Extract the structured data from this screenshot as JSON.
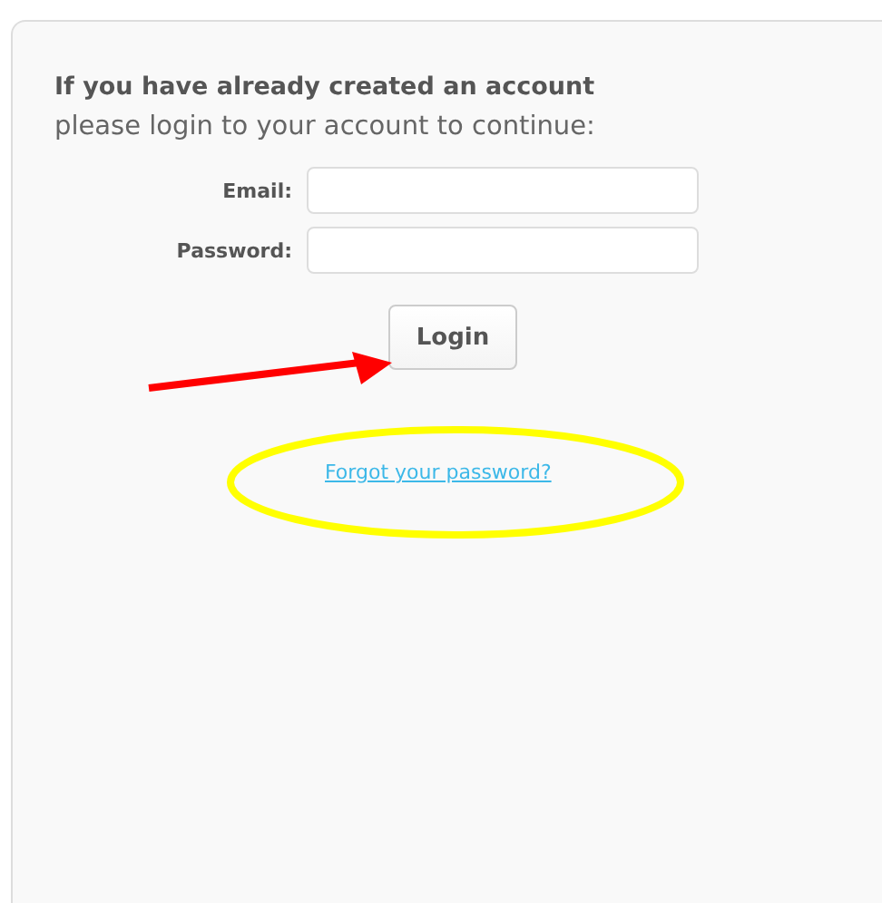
{
  "login_panel": {
    "heading": "If you have already created an account",
    "subheading": "please login to your account to continue:",
    "fields": [
      {
        "label": "Email:"
      },
      {
        "label": "Password:"
      }
    ],
    "login_button": "Login",
    "forgot_link": "Forgot your password?"
  }
}
